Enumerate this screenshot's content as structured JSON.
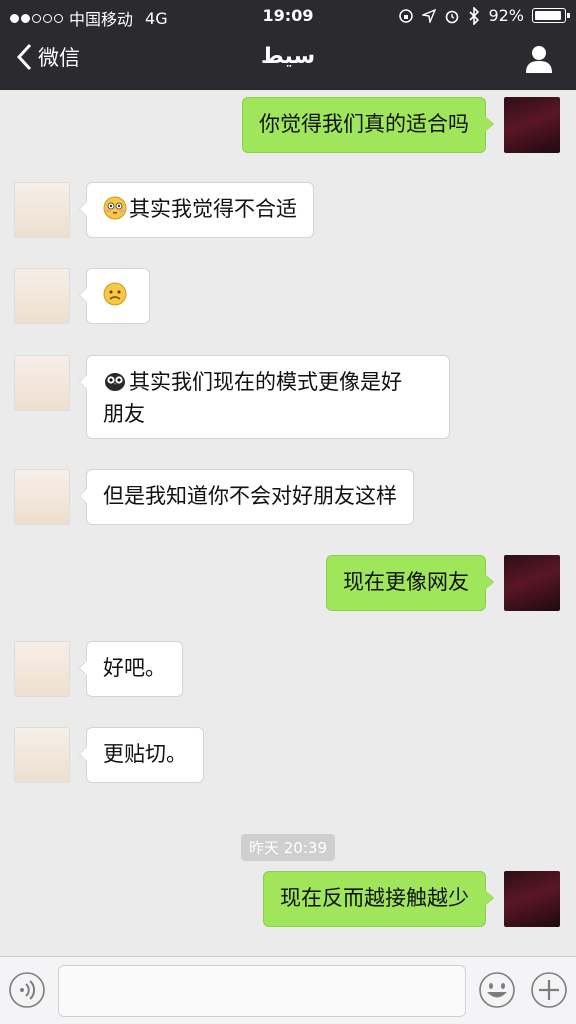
{
  "status_bar": {
    "carrier": "中国移动",
    "network": "4G",
    "time": "19:09",
    "battery": "92%"
  },
  "nav": {
    "back_label": "微信",
    "title": "سيط"
  },
  "messages": [
    {
      "side": "out",
      "text": "你觉得我们真的适合吗"
    },
    {
      "side": "in",
      "emoji": "flushed-face",
      "text": "其实我觉得不合适"
    },
    {
      "side": "in",
      "emoji": "frowning-face",
      "text": ""
    },
    {
      "side": "in",
      "emoji": "owl",
      "line1": "其实我们现在的模式更像是好",
      "line2": "朋友"
    },
    {
      "side": "in",
      "text": "但是我知道你不会对好朋友这样"
    },
    {
      "side": "out",
      "text": "现在更像网友"
    },
    {
      "side": "in",
      "text": "好吧。"
    },
    {
      "side": "in",
      "text": "更贴切。"
    },
    {
      "side": "out",
      "text": "现在反而越接触越少"
    }
  ],
  "timestamp": "昨天 20:39",
  "colors": {
    "header_bg": "#2b2b2f",
    "chat_bg": "#ebebeb",
    "outgoing_bubble": "#9fe65a",
    "incoming_bubble": "#ffffff"
  }
}
